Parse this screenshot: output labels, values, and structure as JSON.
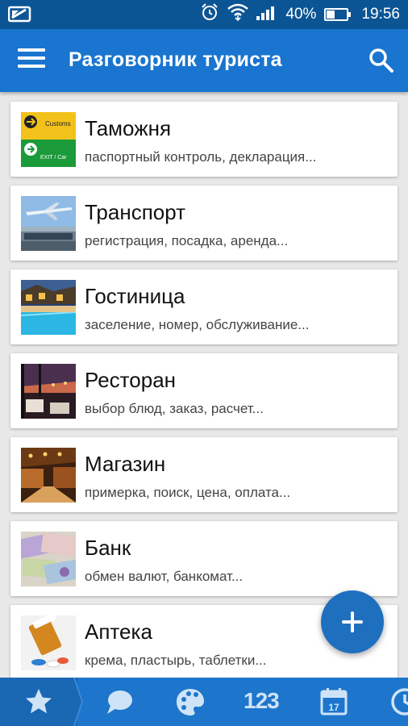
{
  "status_bar": {
    "battery": "40%",
    "time": "19:56",
    "battery_level": 0.4
  },
  "app_bar": {
    "title": "Разговорник туриста"
  },
  "categories": [
    {
      "title": "Таможня",
      "subtitle": "паспортный контроль, декларация..."
    },
    {
      "title": "Транспорт",
      "subtitle": "регистрация, посадка, аренда..."
    },
    {
      "title": "Гостиница",
      "subtitle": "заселение, номер, обслуживание..."
    },
    {
      "title": "Ресторан",
      "subtitle": "выбор блюд, заказ, расчет..."
    },
    {
      "title": "Магазин",
      "subtitle": "примерка, поиск, цена, оплата..."
    },
    {
      "title": "Банк",
      "subtitle": "обмен валют, банкомат..."
    },
    {
      "title": "Аптека",
      "subtitle": "крема, пластырь, таблетки..."
    }
  ],
  "bottom_nav": {
    "numbers_label": "123",
    "calendar_day": "17",
    "items": [
      "star-icon",
      "chat-icon",
      "palette-icon",
      "numbers-icon",
      "calendar-icon",
      "clock-icon"
    ]
  },
  "colors": {
    "primary": "#1975cf",
    "status_bar": "#0c5595",
    "fab": "#1f6fbf"
  },
  "thumb_text": {
    "customs_sign": "Customs",
    "exit_sign": "EXIT / Car"
  }
}
